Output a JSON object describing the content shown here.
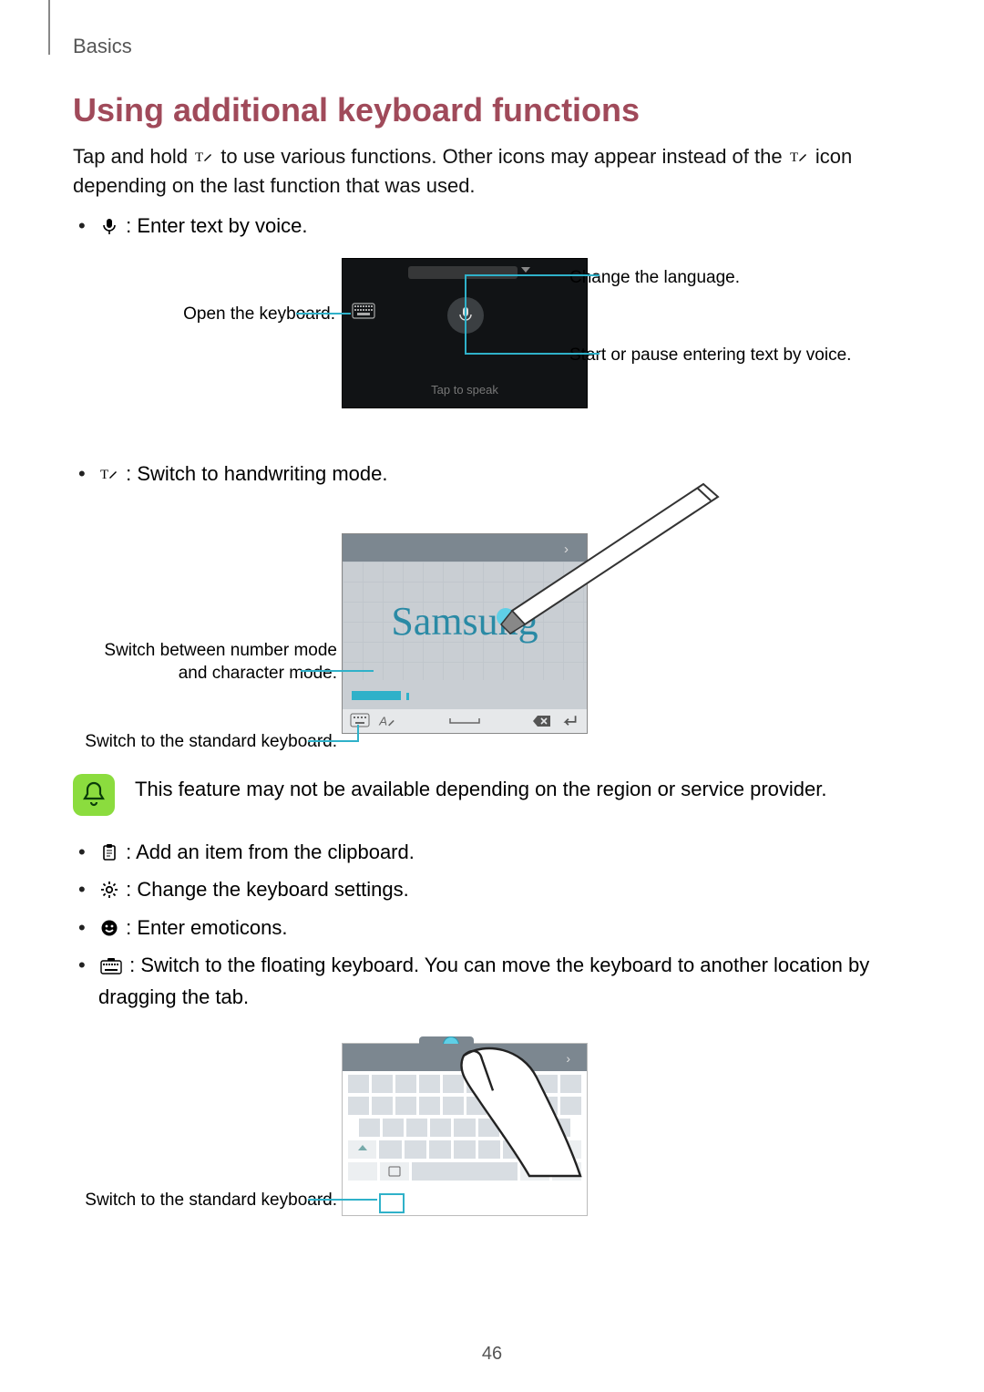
{
  "breadcrumb": "Basics",
  "section_title": "Using additional keyboard functions",
  "intro": {
    "part1": "Tap and hold ",
    "part2": " to use various functions. Other icons may appear instead of the ",
    "part3": " icon depending on the last function that was used."
  },
  "bullets1": {
    "voice": " : Enter text by voice."
  },
  "fig1": {
    "left_label": "Open the keyboard.",
    "right_top_label": "Change the language.",
    "right_bottom_label": "Start or pause entering text by voice.",
    "tap_to_speak": "Tap to speak"
  },
  "bullets2": {
    "handwriting": " : Switch to handwriting mode."
  },
  "fig2": {
    "left_top_label": "Switch between number mode and character mode.",
    "left_bottom_label": "Switch to the standard keyboard.",
    "handwritten_text": "Samsung"
  },
  "note": "This feature may not be available depending on the region or service provider.",
  "bullets3": {
    "clipboard": " : Add an item from the clipboard.",
    "settings": " : Change the keyboard settings.",
    "emoticons": " : Enter emoticons.",
    "floating": " : Switch to the floating keyboard. You can move the keyboard to another location by dragging the tab."
  },
  "fig3": {
    "left_label": "Switch to the standard keyboard."
  },
  "page_number": "46"
}
